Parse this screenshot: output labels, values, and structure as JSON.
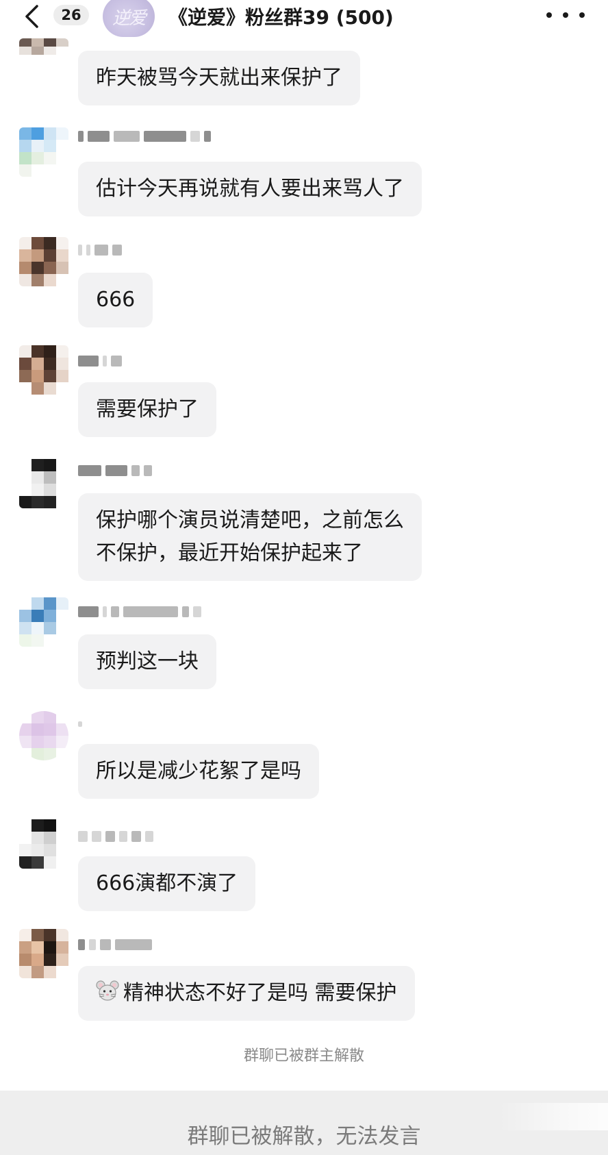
{
  "header": {
    "unread_count": "26",
    "group_logo_text": "逆爱",
    "title": "《逆爱》粉丝群39 (500)",
    "back_icon": "chevron-left-icon",
    "more_icon": "more-dots-icon"
  },
  "messages": [
    {
      "text": "昨天被骂今天就出来保护了"
    },
    {
      "text": "估计今天再说就有人要出来骂人了"
    },
    {
      "text": "666"
    },
    {
      "text": "需要保护了"
    },
    {
      "line1": "保护哪个演员说清楚吧，之前怎么",
      "line2": "不保护，最近开始保护起来了"
    },
    {
      "text": "预判这一块"
    },
    {
      "text": "所以是减少花絮了是吗"
    },
    {
      "text": "666演都不演了"
    },
    {
      "emoji_icon": "mouse-emoji-icon",
      "text": "精神状态不好了是吗 需要保护"
    }
  ],
  "system_notice": "群聊已被群主解散",
  "footer": {
    "disabled_input_text": "群聊已被解散，无法发言"
  },
  "colors": {
    "bubble_bg": "#f2f2f3",
    "footer_bg": "#eeeeee",
    "notice_text": "#8a8a8a"
  }
}
